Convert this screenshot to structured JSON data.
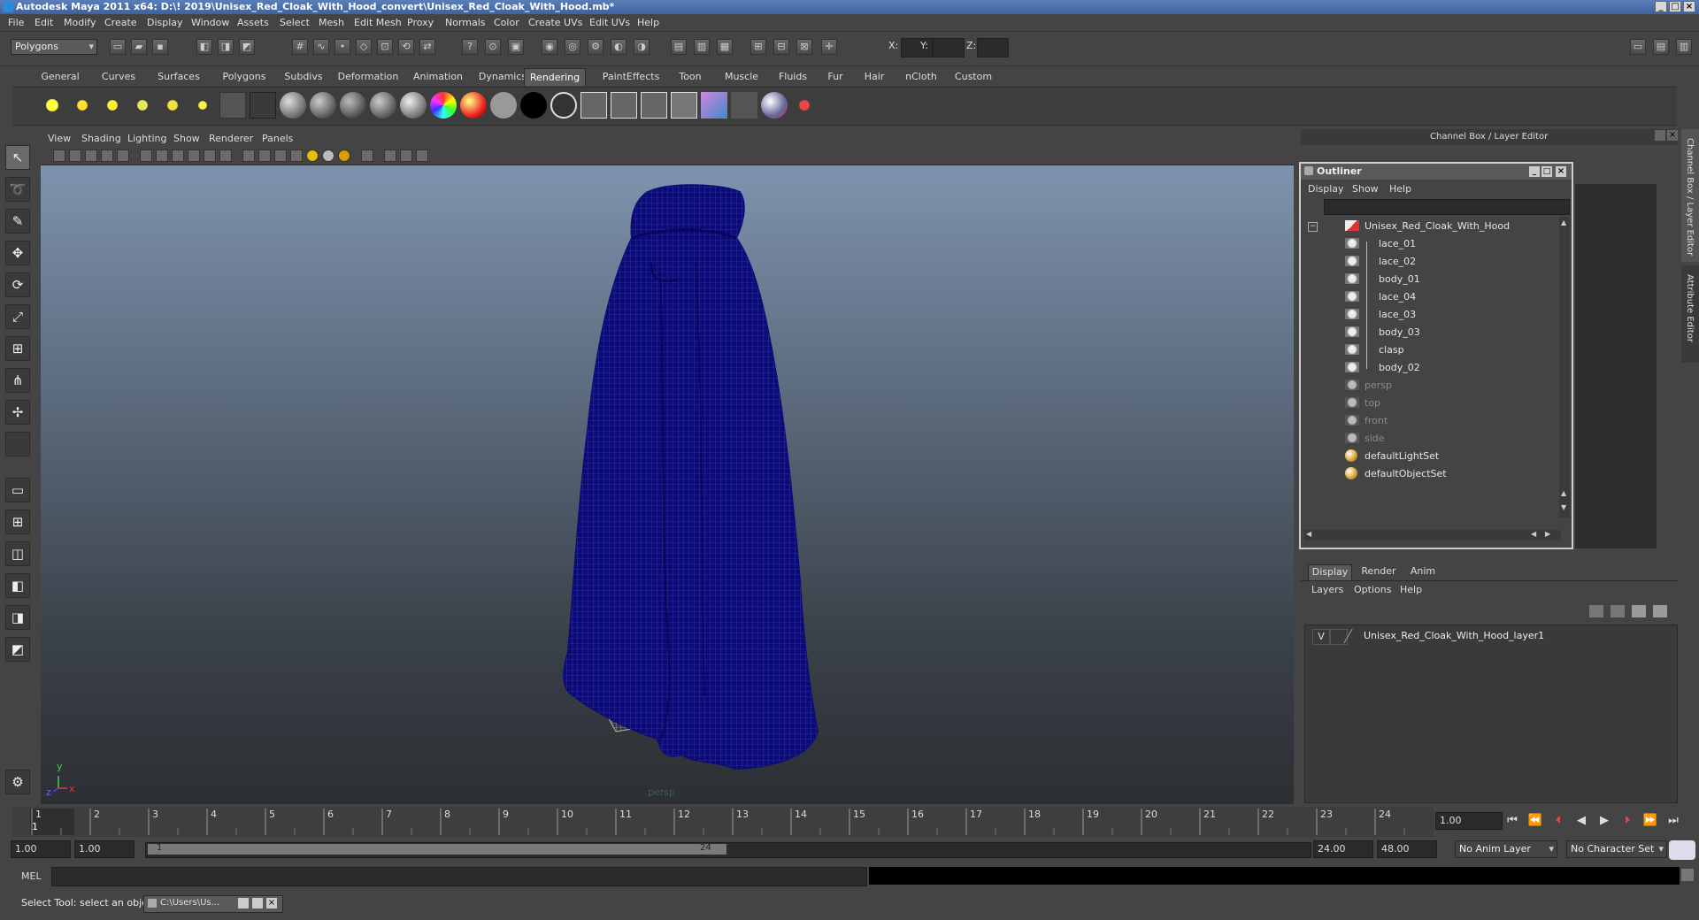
{
  "window": {
    "title": "Autodesk Maya 2011 x64: D:\\! 2019\\Unisex_Red_Cloak_With_Hood_convert\\Unisex_Red_Cloak_With_Hood.mb*",
    "min_label": "_",
    "max_label": "□",
    "close_label": "×"
  },
  "menubar": [
    "File",
    "Edit",
    "Modify",
    "Create",
    "Display",
    "Window",
    "Assets",
    "Select",
    "Mesh",
    "Edit Mesh",
    "Proxy",
    "Normals",
    "Color",
    "Create UVs",
    "Edit UVs",
    "Help"
  ],
  "statusline": {
    "menuset": "Polygons",
    "x_label": "X:",
    "y_label": "Y:",
    "z_label": "Z:"
  },
  "shelf_tabs": [
    "General",
    "Curves",
    "Surfaces",
    "Polygons",
    "Subdivs",
    "Deformation",
    "Animation",
    "Dynamics",
    "Rendering",
    "PaintEffects",
    "Toon",
    "Muscle",
    "Fluids",
    "Fur",
    "Hair",
    "nCloth",
    "Custom"
  ],
  "active_shelf_tab": "Rendering",
  "viewport": {
    "menus": [
      "View",
      "Shading",
      "Lighting",
      "Show",
      "Renderer",
      "Panels"
    ],
    "camera_label": "persp",
    "axis_y": "y",
    "axis_x": "x",
    "axis_z": "z",
    "mesh_color": "#0a0a78"
  },
  "channel_box": {
    "header": "Channel Box / Layer Editor",
    "side_tab_1": "Channel Box / Layer Editor",
    "side_tab_2": "Attribute Editor"
  },
  "outliner": {
    "title": "Outliner",
    "menus": [
      "Display",
      "Show",
      "Help"
    ],
    "root": "Unisex_Red_Cloak_With_Hood",
    "children": [
      "lace_01",
      "lace_02",
      "body_01",
      "lace_04",
      "lace_03",
      "body_03",
      "clasp",
      "body_02"
    ],
    "cameras": [
      "persp",
      "top",
      "front",
      "side"
    ],
    "sets": [
      "defaultLightSet",
      "defaultObjectSet"
    ]
  },
  "layer_editor": {
    "tabs": [
      "Display",
      "Render",
      "Anim"
    ],
    "active_tab": "Display",
    "menus": [
      "Layers",
      "Options",
      "Help"
    ],
    "layer_visibility": "V",
    "layer_name": "Unisex_Red_Cloak_With_Hood_layer1"
  },
  "timeline": {
    "ticks": [
      "1",
      "2",
      "3",
      "4",
      "5",
      "6",
      "7",
      "8",
      "9",
      "10",
      "11",
      "12",
      "13",
      "14",
      "15",
      "16",
      "17",
      "18",
      "19",
      "20",
      "21",
      "22",
      "23",
      "24"
    ],
    "current_frame_marker": "1",
    "current_time": "1.00"
  },
  "range": {
    "start_time": "1.00",
    "playback_start": "1.00",
    "range_start_label": "1",
    "range_end_label": "24",
    "playback_end": "24.00",
    "end_time": "48.00",
    "anim_layer": "No Anim Layer",
    "character_set": "No Character Set"
  },
  "command": {
    "mel_label": "MEL"
  },
  "help": {
    "text": "Select Tool: select an object",
    "taskbar_item": "C:\\Users\\Us..."
  }
}
